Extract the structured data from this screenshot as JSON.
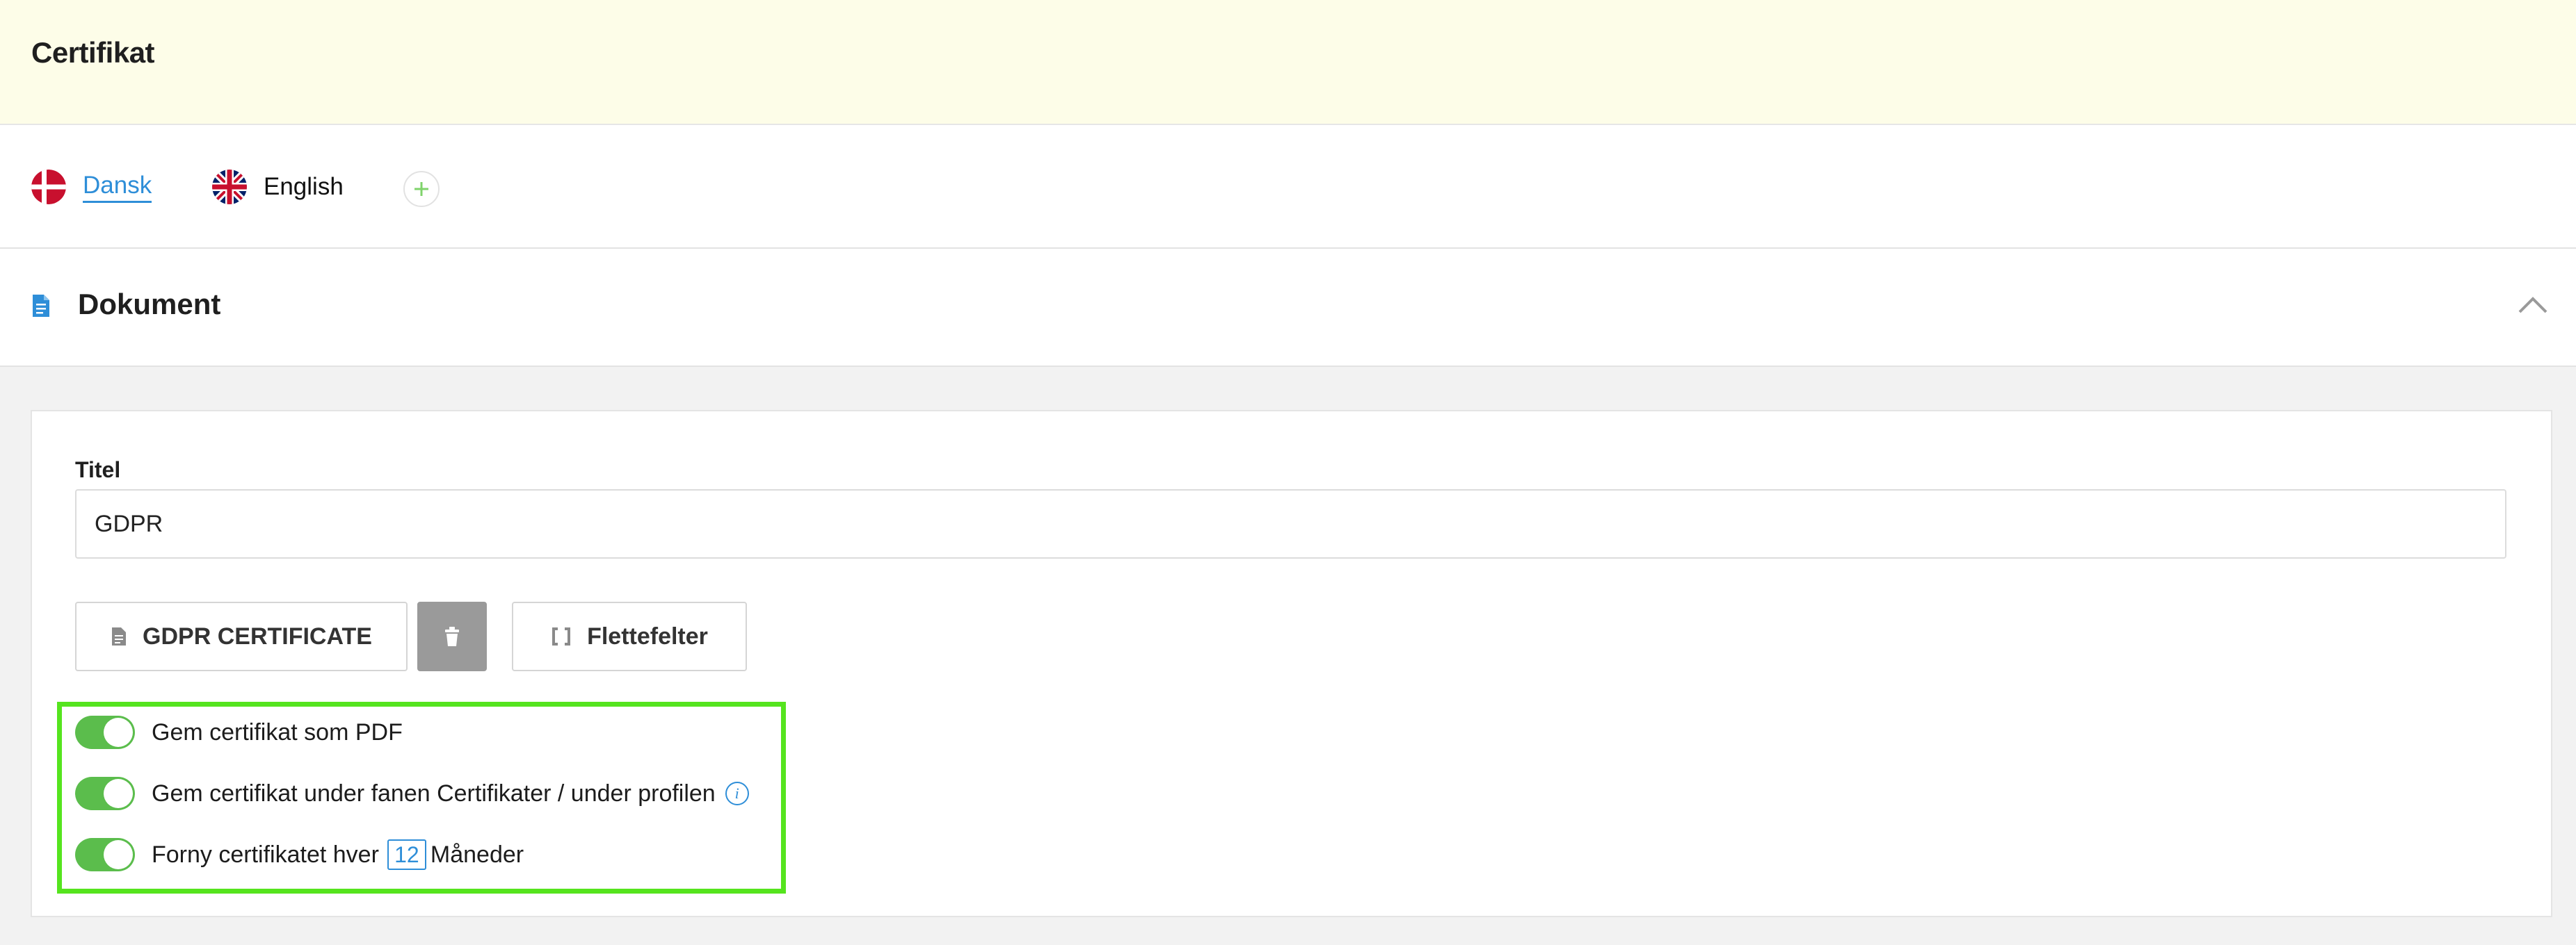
{
  "header": {
    "title": "Certifikat"
  },
  "languages": [
    {
      "label": "Dansk",
      "flag": "denmark-flag-icon",
      "active": true
    },
    {
      "label": "English",
      "flag": "uk-flag-icon",
      "active": false
    }
  ],
  "add_language_icon": "plus-icon",
  "section": {
    "title": "Dokument",
    "icon": "document-icon",
    "collapse_icon": "chevron-up-icon"
  },
  "form": {
    "title_label": "Titel",
    "title_value": "GDPR",
    "certificate_button": "GDPR CERTIFICATE",
    "merge_fields_button": "Flettefelter"
  },
  "toggles": {
    "save_pdf": {
      "label": "Gem certifikat som PDF",
      "on": true
    },
    "save_tab": {
      "label": "Gem certifikat under fanen Certifikater / under profilen",
      "on": true,
      "info_icon": "i"
    },
    "renew": {
      "label_before": "Forny certifikatet hver",
      "months": "12",
      "label_after": "Måneder",
      "on": true
    }
  },
  "colors": {
    "accent": "#2e8ed8",
    "toggle_on": "#5bbd4c",
    "highlight": "#55e41e",
    "header_bg": "#fdfde8"
  }
}
